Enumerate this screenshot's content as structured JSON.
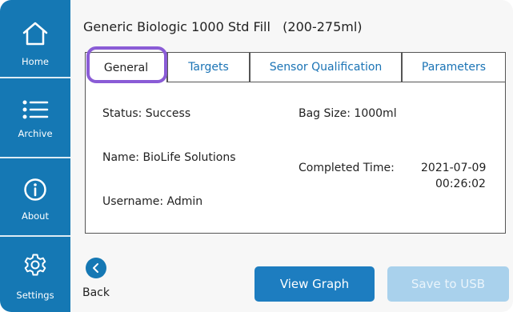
{
  "sidebar": {
    "items": [
      {
        "label": "Home",
        "icon": "home-icon"
      },
      {
        "label": "Archive",
        "icon": "list-icon"
      },
      {
        "label": "About",
        "icon": "info-icon"
      },
      {
        "label": "Settings",
        "icon": "gear-icon"
      }
    ]
  },
  "header": {
    "title": "Generic Biologic 1000 Std Fill   (200-275ml)"
  },
  "tabs": [
    {
      "label": "General",
      "active": true
    },
    {
      "label": "Targets",
      "active": false
    },
    {
      "label": "Sensor Qualification",
      "active": false
    },
    {
      "label": "Parameters",
      "active": false
    }
  ],
  "details": {
    "status": "Status: Success",
    "bag_size": "Bag Size: 1000ml",
    "name": "Name: BioLife Solutions",
    "completed_label": "Completed Time:",
    "completed_date": "2021-07-09",
    "completed_time": "00:26:02",
    "username": "Username: Admin"
  },
  "footer": {
    "back_label": "Back",
    "view_graph": "View Graph",
    "save_usb": "Save to USB"
  },
  "colors": {
    "sidebar": "#1578b4",
    "primary_button": "#1d7dc0",
    "disabled_button": "#a9d1ec",
    "tab_link": "#1a73b5",
    "highlight": "#8a5cd6"
  }
}
